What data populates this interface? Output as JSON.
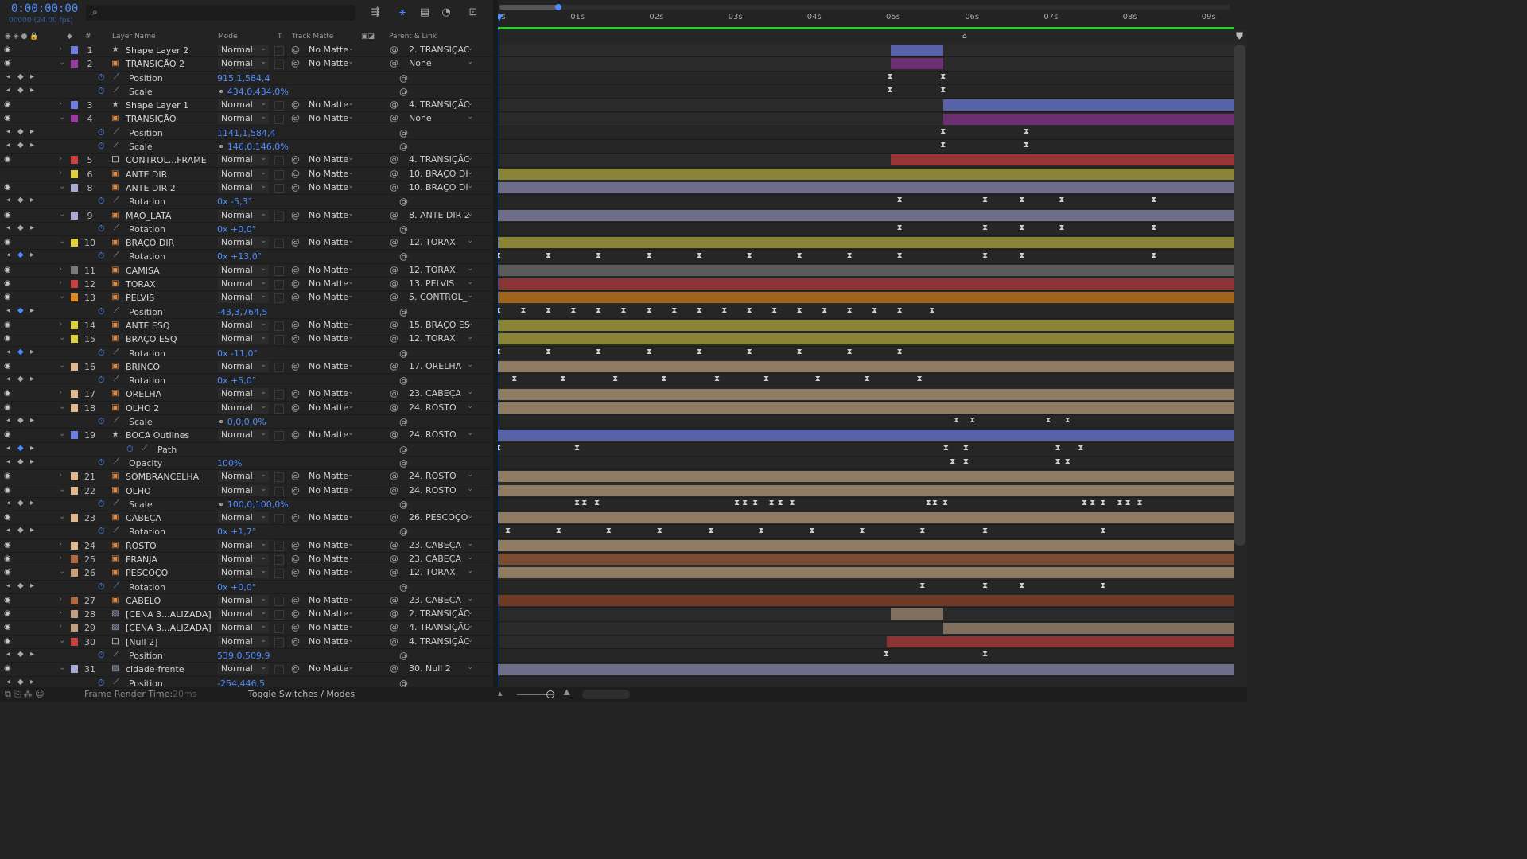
{
  "timecode": "0:00:00:00",
  "fps_label": "00000 (24.00 fps)",
  "search": {
    "icon": "search-icon",
    "placeholder": ""
  },
  "columns": {
    "layer_name": "Layer Name",
    "mode": "Mode",
    "t": "T",
    "track_matte": "Track Matte",
    "parent": "Parent & Link",
    "num": "#"
  },
  "ruler": [
    "0s",
    "01s",
    "02s",
    "03s",
    "04s",
    "05s",
    "06s",
    "07s",
    "08s",
    "09s"
  ],
  "rows": [
    {
      "type": "layer",
      "num": "1",
      "name": "Shape Layer 2",
      "color": "#6d7ee0",
      "icon": "star",
      "mode": "Normal",
      "matte": "No Matte",
      "parent": "2. TRANSIÇÃC",
      "tw": "closed",
      "eye": true,
      "bars": [
        {
          "s": 0.533,
          "e": 0.605,
          "c": "#5862a8"
        }
      ],
      "kf": []
    },
    {
      "type": "layer",
      "num": "2",
      "name": "TRANSIÇÃO 2",
      "color": "#9a3aa0",
      "icon": "comp",
      "mode": "Normal",
      "matte": "No Matte",
      "parent": "None",
      "tw": "open",
      "eye": true,
      "bars": [
        {
          "s": 0.533,
          "e": 0.605,
          "c": "#6e2f72"
        }
      ],
      "kf": []
    },
    {
      "type": "prop",
      "name": "Position",
      "value": "915,1,584,4",
      "kf": [
        0.533,
        0.605
      ]
    },
    {
      "type": "prop",
      "name": "Scale",
      "value": "434,0,434,0%",
      "link": true,
      "kf": [
        0.533,
        0.605
      ]
    },
    {
      "type": "layer",
      "num": "3",
      "name": "Shape Layer 1",
      "color": "#6d7ee0",
      "icon": "star",
      "mode": "Normal",
      "matte": "No Matte",
      "parent": "4. TRANSIÇÃC",
      "tw": "closed",
      "eye": true,
      "bars": [
        {
          "s": 0.605,
          "e": 1,
          "c": "#5862a8"
        }
      ],
      "kf": []
    },
    {
      "type": "layer",
      "num": "4",
      "name": "TRANSIÇÃO",
      "color": "#9a3aa0",
      "icon": "comp",
      "mode": "Normal",
      "matte": "No Matte",
      "parent": "None",
      "tw": "open",
      "eye": true,
      "bars": [
        {
          "s": 0.605,
          "e": 1,
          "c": "#6e2f72"
        }
      ],
      "kf": []
    },
    {
      "type": "prop",
      "name": "Position",
      "value": "1141,1,584,4",
      "kf": [
        0.605,
        0.718
      ]
    },
    {
      "type": "prop",
      "name": "Scale",
      "value": "146,0,146,0%",
      "link": true,
      "kf": [
        0.605,
        0.718
      ]
    },
    {
      "type": "layer",
      "num": "5",
      "name": "CONTROL...FRAME",
      "color": "#c94040",
      "icon": "null",
      "mode": "Normal",
      "matte": "No Matte",
      "parent": "4. TRANSIÇÃC",
      "tw": "closed",
      "eye": true,
      "bars": [
        {
          "s": 0.533,
          "e": 1,
          "c": "#9a3535"
        }
      ],
      "kf": []
    },
    {
      "type": "layer",
      "num": "6",
      "name": "ANTE DIR",
      "color": "#e0d040",
      "icon": "comp",
      "mode": "Normal",
      "matte": "No Matte",
      "parent": "10. BRAÇO DI",
      "tw": "closed",
      "eye": false,
      "bars": [
        {
          "s": 0,
          "e": 1,
          "c": "#8a8438"
        }
      ],
      "kf": []
    },
    {
      "type": "layer",
      "num": "8",
      "name": "ANTE DIR 2",
      "color": "#a9a9d6",
      "icon": "comp",
      "mode": "Normal",
      "matte": "No Matte",
      "parent": "10. BRAÇO DI",
      "tw": "open",
      "eye": true,
      "bars": [
        {
          "s": 0,
          "e": 1,
          "c": "#6e6e8a"
        }
      ],
      "kf": []
    },
    {
      "type": "prop",
      "name": "Rotation",
      "value": "0x -5,3°",
      "kf": [
        0.546,
        0.662,
        0.712,
        0.766,
        0.891
      ]
    },
    {
      "type": "layer",
      "num": "9",
      "name": "MAO_LATA",
      "color": "#a9a9d6",
      "icon": "comp",
      "mode": "Normal",
      "matte": "No Matte",
      "parent": "8. ANTE DIR 2",
      "tw": "open",
      "eye": true,
      "bars": [
        {
          "s": 0,
          "e": 1,
          "c": "#6e6e8a"
        }
      ],
      "kf": []
    },
    {
      "type": "prop",
      "name": "Rotation",
      "value": "0x +0,0°",
      "kf": [
        0.546,
        0.662,
        0.712,
        0.766,
        0.891
      ]
    },
    {
      "type": "layer",
      "num": "10",
      "name": "BRAÇO DIR",
      "color": "#e0d040",
      "icon": "comp",
      "mode": "Normal",
      "matte": "No Matte",
      "parent": "12. TORAX",
      "tw": "open",
      "eye": true,
      "bars": [
        {
          "s": 0,
          "e": 1,
          "c": "#8a8438"
        }
      ],
      "kf": []
    },
    {
      "type": "prop",
      "name": "Rotation",
      "value": "0x +13,0°",
      "blue": true,
      "kf": [
        0.001,
        0.069,
        0.137,
        0.206,
        0.274,
        0.342,
        0.41,
        0.478,
        0.546,
        0.662,
        0.712,
        0.891
      ]
    },
    {
      "type": "layer",
      "num": "11",
      "name": "CAMISA",
      "color": "#7a7a7a",
      "icon": "comp",
      "mode": "Normal",
      "matte": "No Matte",
      "parent": "12. TORAX",
      "tw": "closed",
      "eye": true,
      "bars": [
        {
          "s": 0,
          "e": 1,
          "c": "#5a5a5a"
        }
      ],
      "kf": []
    },
    {
      "type": "layer",
      "num": "12",
      "name": "TORAX",
      "color": "#c94040",
      "icon": "comp",
      "mode": "Normal",
      "matte": "No Matte",
      "parent": "13. PELVIS",
      "tw": "closed",
      "eye": true,
      "bars": [
        {
          "s": 0,
          "e": 1,
          "c": "#8a3535"
        }
      ],
      "kf": []
    },
    {
      "type": "layer",
      "num": "13",
      "name": "PELVIS",
      "color": "#e08a20",
      "icon": "comp",
      "mode": "Normal",
      "matte": "No Matte",
      "parent": "5. CONTROL_",
      "tw": "open",
      "eye": true,
      "bars": [
        {
          "s": 0,
          "e": 1,
          "c": "#a0641e"
        }
      ],
      "kf": []
    },
    {
      "type": "prop",
      "name": "Position",
      "value": "-43,3,764,5",
      "blue": true,
      "kf": [
        0.001,
        0.035,
        0.069,
        0.103,
        0.137,
        0.171,
        0.206,
        0.24,
        0.274,
        0.308,
        0.342,
        0.376,
        0.41,
        0.444,
        0.478,
        0.512,
        0.546,
        0.59
      ]
    },
    {
      "type": "layer",
      "num": "14",
      "name": "ANTE ESQ",
      "color": "#e0d040",
      "icon": "comp",
      "mode": "Normal",
      "matte": "No Matte",
      "parent": "15. BRAÇO ES",
      "tw": "closed",
      "eye": true,
      "bars": [
        {
          "s": 0,
          "e": 1,
          "c": "#8a8438"
        }
      ],
      "kf": []
    },
    {
      "type": "layer",
      "num": "15",
      "name": "BRAÇO ESQ",
      "color": "#e0d040",
      "icon": "comp",
      "mode": "Normal",
      "matte": "No Matte",
      "parent": "12. TORAX",
      "tw": "open",
      "eye": true,
      "bars": [
        {
          "s": 0,
          "e": 1,
          "c": "#8a8438"
        }
      ],
      "kf": []
    },
    {
      "type": "prop",
      "name": "Rotation",
      "value": "0x -11,0°",
      "blue": true,
      "kf": [
        0.001,
        0.069,
        0.137,
        0.206,
        0.274,
        0.342,
        0.41,
        0.478,
        0.546
      ]
    },
    {
      "type": "layer",
      "num": "16",
      "name": "BRINCO",
      "color": "#e0b890",
      "icon": "comp",
      "mode": "Normal",
      "matte": "No Matte",
      "parent": "17. ORELHA",
      "tw": "open",
      "eye": true,
      "bars": [
        {
          "s": 0,
          "e": 1,
          "c": "#8f7a63"
        }
      ],
      "kf": []
    },
    {
      "type": "prop",
      "name": "Rotation",
      "value": "0x +5,0°",
      "kf": [
        0.023,
        0.089,
        0.16,
        0.226,
        0.298,
        0.365,
        0.435,
        0.502,
        0.573
      ]
    },
    {
      "type": "layer",
      "num": "17",
      "name": "ORELHA",
      "color": "#e0b890",
      "icon": "comp",
      "mode": "Normal",
      "matte": "No Matte",
      "parent": "23. CABEÇA",
      "tw": "closed",
      "eye": true,
      "bars": [
        {
          "s": 0,
          "e": 1,
          "c": "#8f7a63"
        }
      ],
      "kf": []
    },
    {
      "type": "layer",
      "num": "18",
      "name": "OLHO 2",
      "color": "#e0b890",
      "icon": "comp",
      "mode": "Normal",
      "matte": "No Matte",
      "parent": "24. ROSTO",
      "tw": "open",
      "eye": true,
      "bars": [
        {
          "s": 0,
          "e": 1,
          "c": "#8f7a63"
        }
      ],
      "kf": []
    },
    {
      "type": "prop",
      "name": "Scale",
      "value": "0,0,0,0%",
      "link": true,
      "kf": [
        0.623,
        0.645,
        0.748,
        0.774
      ]
    },
    {
      "type": "layer",
      "num": "19",
      "name": "BOCA Outlines",
      "color": "#6d7ee0",
      "icon": "star",
      "mode": "Normal",
      "matte": "No Matte",
      "parent": "24. ROSTO",
      "tw": "open",
      "eye": true,
      "bars": [
        {
          "s": 0,
          "e": 1,
          "c": "#5862a8"
        }
      ],
      "kf": []
    },
    {
      "type": "prop",
      "name": "Path",
      "value": "",
      "indent": true,
      "blue": true,
      "kf": [
        0.001,
        0.108,
        0.609,
        0.636,
        0.761,
        0.792
      ]
    },
    {
      "type": "prop",
      "name": "Opacity",
      "value": "100%",
      "kf": [
        0.618,
        0.636,
        0.761,
        0.774
      ]
    },
    {
      "type": "layer",
      "num": "21",
      "name": "SOMBRANCELHA",
      "color": "#e0b890",
      "icon": "comp",
      "mode": "Normal",
      "matte": "No Matte",
      "parent": "24. ROSTO",
      "tw": "closed",
      "eye": true,
      "bars": [
        {
          "s": 0,
          "e": 1,
          "c": "#8f7a63"
        }
      ],
      "kf": []
    },
    {
      "type": "layer",
      "num": "22",
      "name": "OLHO",
      "color": "#e0b890",
      "icon": "comp",
      "mode": "Normal",
      "matte": "No Matte",
      "parent": "24. ROSTO",
      "tw": "open",
      "eye": true,
      "bars": [
        {
          "s": 0,
          "e": 1,
          "c": "#8f7a63"
        }
      ],
      "kf": []
    },
    {
      "type": "prop",
      "name": "Scale",
      "value": "100,0,100,0%",
      "link": true,
      "kf": [
        0.108,
        0.118,
        0.135,
        0.325,
        0.336,
        0.35,
        0.372,
        0.384,
        0.4,
        0.585,
        0.594,
        0.608,
        0.797,
        0.808,
        0.822,
        0.845,
        0.856,
        0.872
      ]
    },
    {
      "type": "layer",
      "num": "23",
      "name": "CABEÇA",
      "color": "#e0b890",
      "icon": "comp",
      "mode": "Normal",
      "matte": "No Matte",
      "parent": "26. PESCOÇO",
      "tw": "open",
      "eye": true,
      "bars": [
        {
          "s": 0,
          "e": 1,
          "c": "#8f7a63"
        }
      ],
      "kf": []
    },
    {
      "type": "prop",
      "name": "Rotation",
      "value": "0x +1,7°",
      "kf": [
        0.014,
        0.083,
        0.151,
        0.22,
        0.29,
        0.358,
        0.427,
        0.495,
        0.577,
        0.662,
        0.822
      ]
    },
    {
      "type": "layer",
      "num": "24",
      "name": "ROSTO",
      "color": "#e0b890",
      "icon": "comp",
      "mode": "Normal",
      "matte": "No Matte",
      "parent": "23. CABEÇA",
      "tw": "closed",
      "eye": true,
      "bars": [
        {
          "s": 0,
          "e": 1,
          "c": "#8f7a63"
        }
      ],
      "kf": []
    },
    {
      "type": "layer",
      "num": "25",
      "name": "FRANJA",
      "color": "#b06840",
      "icon": "comp",
      "mode": "Normal",
      "matte": "No Matte",
      "parent": "23. CABEÇA",
      "tw": "closed",
      "eye": true,
      "bars": [
        {
          "s": 0,
          "e": 1,
          "c": "#7a4c32"
        }
      ],
      "kf": []
    },
    {
      "type": "layer",
      "num": "26",
      "name": "PESCOÇO",
      "color": "#c8a078",
      "icon": "comp",
      "mode": "Normal",
      "matte": "No Matte",
      "parent": "12. TORAX",
      "tw": "open",
      "eye": true,
      "bars": [
        {
          "s": 0,
          "e": 1,
          "c": "#8f7a63"
        }
      ],
      "kf": []
    },
    {
      "type": "prop",
      "name": "Rotation",
      "value": "0x +0,0°",
      "kf": [
        0.577,
        0.662,
        0.712,
        0.822
      ]
    },
    {
      "type": "layer",
      "num": "27",
      "name": "CABELO",
      "color": "#b06840",
      "icon": "comp",
      "mode": "Normal",
      "matte": "No Matte",
      "parent": "23. CABEÇA",
      "tw": "closed",
      "eye": true,
      "bars": [
        {
          "s": 0,
          "e": 1,
          "c": "#6e3a26"
        }
      ],
      "kf": []
    },
    {
      "type": "layer",
      "num": "28",
      "name": "[CENA 3...ALIZADA]",
      "color": "#c0a080",
      "icon": "image",
      "mode": "Normal",
      "matte": "No Matte",
      "parent": "2. TRANSIÇÃC",
      "tw": "closed",
      "eye": true,
      "bars": [
        {
          "s": 0.533,
          "e": 0.605,
          "c": "#807060"
        }
      ],
      "kf": []
    },
    {
      "type": "layer",
      "num": "29",
      "name": "[CENA 3...ALIZADA]",
      "color": "#c0a080",
      "icon": "image",
      "mode": "Normal",
      "matte": "No Matte",
      "parent": "4. TRANSIÇÃC",
      "tw": "closed",
      "eye": true,
      "bars": [
        {
          "s": 0.605,
          "e": 1,
          "c": "#807060"
        }
      ],
      "kf": []
    },
    {
      "type": "layer",
      "num": "30",
      "name": "[Null 2]",
      "color": "#c94040",
      "icon": "null",
      "mode": "Normal",
      "matte": "No Matte",
      "parent": "4. TRANSIÇÃC",
      "tw": "open",
      "eye": true,
      "bars": [
        {
          "s": 0.528,
          "e": 1,
          "c": "#8a3535"
        }
      ],
      "kf": []
    },
    {
      "type": "prop",
      "name": "Position",
      "value": "539,0,509,9",
      "kf": [
        0.528,
        0.662
      ]
    },
    {
      "type": "layer",
      "num": "31",
      "name": "cidade-frente",
      "color": "#a9a9d6",
      "icon": "image",
      "mode": "Normal",
      "matte": "No Matte",
      "parent": "30. Null 2",
      "tw": "open",
      "eye": true,
      "bars": [
        {
          "s": 0,
          "e": 1,
          "c": "#6e6e8a"
        }
      ],
      "kf": []
    },
    {
      "type": "prop",
      "name": "Position",
      "value": "-254,446,5",
      "kf": []
    }
  ],
  "bottom": {
    "render_label": "Frame Render Time:",
    "render_value": "20ms",
    "toggle": "Toggle Switches / Modes"
  }
}
